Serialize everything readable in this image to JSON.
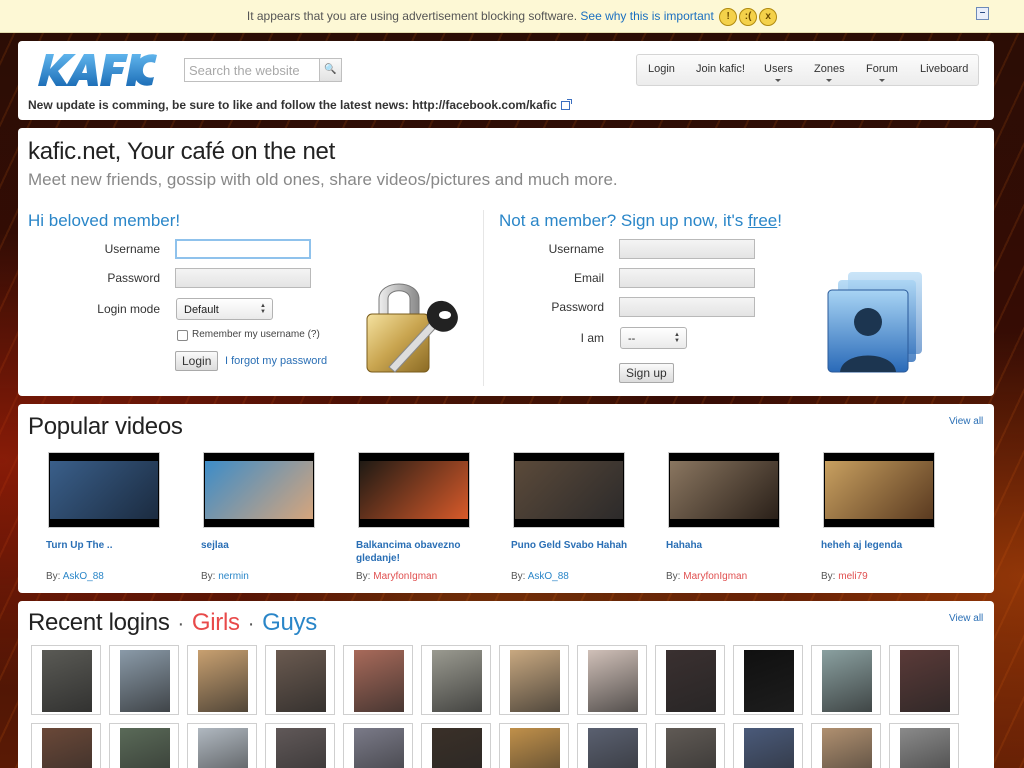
{
  "adbar": {
    "message": "It appears that you are using advertisement blocking software.",
    "link": "See why this is important",
    "smileys": [
      "surprised-face-icon",
      "sad-face-icon",
      "angry-face-icon"
    ]
  },
  "header": {
    "logo_text": "KAFIC",
    "search_placeholder": "Search the website",
    "nav": [
      "Login",
      "Join kafic!",
      "Users",
      "Zones",
      "Forum",
      "Liveboard"
    ],
    "news": "New update is comming, be sure to like and follow the latest news: http://facebook.com/kafic"
  },
  "main": {
    "title": "kafic.net, Your café on the net",
    "subtitle": "Meet new friends, gossip with old ones, share videos/pictures and much more.",
    "login": {
      "heading": "Hi beloved member!",
      "username_label": "Username",
      "password_label": "Password",
      "mode_label": "Login mode",
      "mode_value": "Default",
      "remember_label": "Remember my username (?)",
      "login_button": "Login",
      "forgot_link": "I forgot my password"
    },
    "signup": {
      "heading_pre": "Not a member? Sign up now, it's ",
      "heading_free": "free",
      "heading_post": "!",
      "username_label": "Username",
      "email_label": "Email",
      "password_label": "Password",
      "iam_label": "I am",
      "iam_value": "--",
      "signup_button": "Sign up"
    }
  },
  "videos": {
    "title": "Popular videos",
    "view_all": "View all",
    "by": "By:",
    "items": [
      {
        "title": "Turn Up The ..",
        "user": "AskO_88",
        "pink": false,
        "c1": "#3a5f8a",
        "c2": "#1b2b40"
      },
      {
        "title": "sejlaa",
        "user": "nermin",
        "pink": false,
        "c1": "#3c8cc8",
        "c2": "#d6a57c"
      },
      {
        "title": "Balkancima obavezno gledanje!",
        "user": "MaryfonIgman",
        "pink": true,
        "c1": "#1f1a14",
        "c2": "#d85a2a"
      },
      {
        "title": "Puno Geld Svabo Hahah",
        "user": "AskO_88",
        "pink": false,
        "c1": "#5b4a3a",
        "c2": "#2c2a2a"
      },
      {
        "title": "Hahaha",
        "user": "MaryfonIgman",
        "pink": true,
        "c1": "#8a7660",
        "c2": "#2a2019"
      },
      {
        "title": "heheh aj legenda",
        "user": "meli79",
        "pink": true,
        "c1": "#c8a060",
        "c2": "#5a3a20"
      }
    ]
  },
  "logins": {
    "title": "Recent logins",
    "sep": "·",
    "girls": "Girls",
    "guys": "Guys",
    "view_all": "View all",
    "colors": [
      "#5a5a55",
      "#8a9aa8",
      "#c8a070",
      "#6a5a50",
      "#a86a5a",
      "#9a9a90",
      "#c8a880",
      "#d0c0b8",
      "#3a3030",
      "#101010",
      "#8aa0a0",
      "#5a3a38",
      "#6a4838",
      "#5a6a58",
      "#b0b8c0",
      "#605858",
      "#7a7a88",
      "#3a3028",
      "#c0904a",
      "#5a6070",
      "#605a55",
      "#4a5a7a",
      "#b09070",
      "#8a8a8a"
    ]
  }
}
